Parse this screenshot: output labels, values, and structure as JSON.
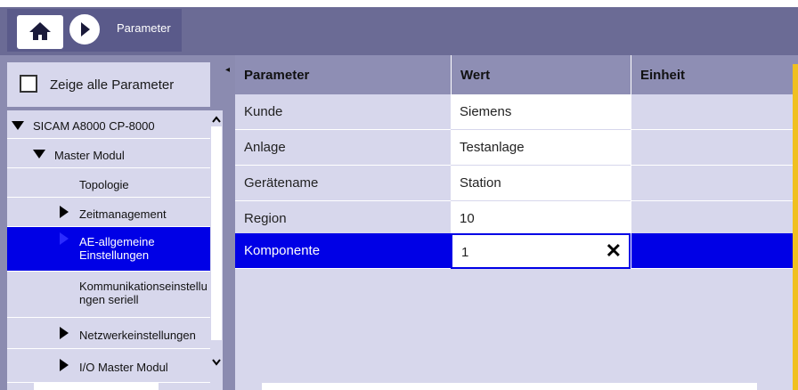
{
  "header": {
    "breadcrumb": "Parameter"
  },
  "left_panel": {
    "show_all_label": "Zeige alle Parameter",
    "tree": [
      {
        "label": "SICAM A8000 CP-8000",
        "expanded": true
      },
      {
        "label": "Master Modul",
        "expanded": true
      },
      {
        "label": "Topologie"
      },
      {
        "label": "Zeitmanagement",
        "expandable": true
      },
      {
        "label": "AE-allgemeine Einstellungen",
        "expandable": true,
        "selected": true
      },
      {
        "label": "Kommunikationseinstellungen seriell"
      },
      {
        "label": "Netzwerkeinstellungen",
        "expandable": true
      },
      {
        "label": "I/O Master Modul",
        "expandable": true
      }
    ]
  },
  "table": {
    "columns": [
      "Parameter",
      "Wert",
      "Einheit"
    ],
    "rows": [
      {
        "parameter": "Kunde",
        "value": "Siemens",
        "unit": ""
      },
      {
        "parameter": "Anlage",
        "value": "Testanlage",
        "unit": ""
      },
      {
        "parameter": "Gerätename",
        "value": "Station",
        "unit": ""
      },
      {
        "parameter": "Region",
        "value": "10",
        "unit": ""
      },
      {
        "parameter": "Komponente",
        "value": "1",
        "unit": "",
        "selected": true
      }
    ]
  },
  "colors": {
    "selection": "#0000e6",
    "header_bg": "#6b6b95",
    "panel_bg": "#d7d7ec",
    "accent_bar": "#f0c020"
  }
}
